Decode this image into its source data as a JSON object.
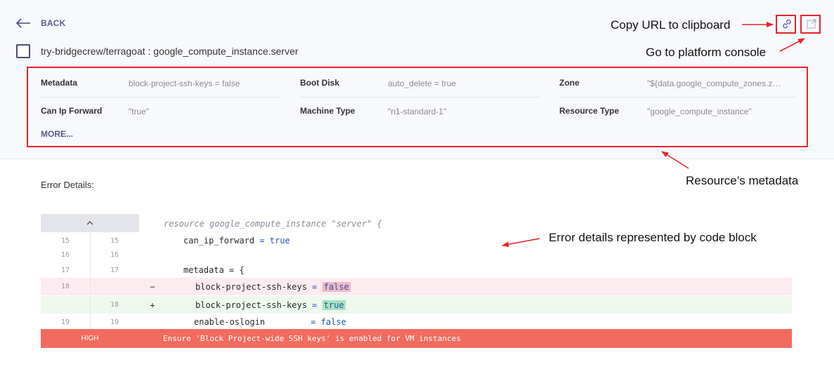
{
  "header": {
    "back_label": "BACK",
    "resource_title": "try-bridgecrew/terragoat : google_compute_instance.server"
  },
  "icons": {
    "back": "arrow-left-icon",
    "copy": "link-icon",
    "external": "external-link-icon",
    "expand": "chevron-up-icon"
  },
  "metadata": {
    "fields": [
      {
        "label": "Metadata",
        "value": "block-project-ssh-keys = false"
      },
      {
        "label": "Boot Disk",
        "value": "auto_delete = true"
      },
      {
        "label": "Zone",
        "value": "\"${data.google_compute_zones.z…"
      },
      {
        "label": "Can Ip Forward",
        "value": "\"true\""
      },
      {
        "label": "Machine Type",
        "value": "\"n1-standard-1\""
      },
      {
        "label": "Resource Type",
        "value": "\"google_compute_instance\""
      }
    ],
    "more_label": "MORE..."
  },
  "error_details": {
    "label": "Error Details:",
    "resource_line": "resource google_compute_instance \"server\" {",
    "lines": [
      {
        "old": "15",
        "new": "15",
        "mark": "",
        "type": "context",
        "key": "can_ip_forward",
        "op": " = ",
        "val": "true"
      },
      {
        "old": "16",
        "new": "16",
        "mark": "",
        "type": "context",
        "key": "",
        "op": "",
        "val": ""
      },
      {
        "old": "17",
        "new": "17",
        "mark": "",
        "type": "context",
        "key": "metadata = {",
        "op": "",
        "val": ""
      },
      {
        "old": "18",
        "new": "",
        "mark": "−",
        "type": "removed",
        "key": "block-project-ssh-keys",
        "op": " = ",
        "val": "false"
      },
      {
        "old": "",
        "new": "18",
        "mark": "+",
        "type": "added",
        "key": "block-project-ssh-keys",
        "op": " = ",
        "val": "true"
      },
      {
        "old": "19",
        "new": "19",
        "mark": "",
        "type": "context",
        "key": "enable-oslogin        ",
        "op": " = ",
        "val": "false"
      }
    ],
    "severity": "HIGH",
    "message": "Ensure 'Block Project-wide SSH keys' is enabled for VM instances"
  },
  "annotations": {
    "copy_url": "Copy URL to clipboard",
    "platform_console": "Go to platform console",
    "metadata": "Resource’s metadata",
    "code_block": "Error details represented by code block"
  },
  "colors": {
    "accent": "#5a5a8c",
    "callout": "#e8242a",
    "error_bar": "#f26b5f",
    "removed_bg": "#fdecef",
    "added_bg": "#eef8ee"
  }
}
